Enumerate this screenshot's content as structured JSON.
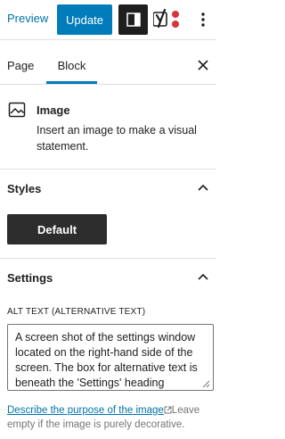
{
  "toolbar": {
    "preview_label": "Preview",
    "update_label": "Update",
    "settings_toggle_icon": "sidebar-panel-icon",
    "plugin_icon": "yoast-icon",
    "more_icon": "vertical-ellipsis-icon",
    "update_color": "#007cba"
  },
  "tabs": {
    "page_label": "Page",
    "block_label": "Block",
    "active": "Block",
    "close_icon": "close-icon"
  },
  "block_card": {
    "icon": "image-icon",
    "title": "Image",
    "description": "Insert an image to make a visual statement."
  },
  "styles_panel": {
    "title": "Styles",
    "default_label": "Default"
  },
  "settings_panel": {
    "title": "Settings",
    "alt_label": "ALT TEXT (ALTERNATIVE TEXT)",
    "alt_value": "A screen shot of the settings window located on the right-hand side of the screen. The box for alternative text is beneath the 'Settings' heading",
    "help_link": "Describe the purpose of the image",
    "help_rest": "Leave empty if the image is purely decorative."
  }
}
